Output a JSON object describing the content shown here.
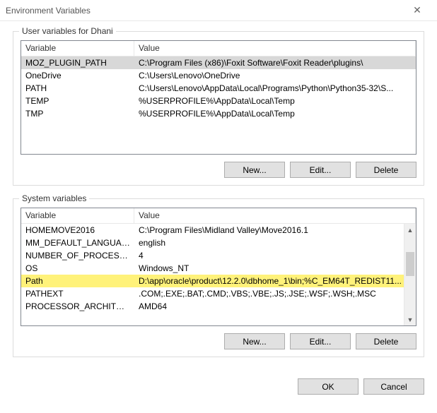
{
  "window": {
    "title": "Environment Variables",
    "close_glyph": "✕"
  },
  "user_section": {
    "label": "User variables for Dhani",
    "col_variable": "Variable",
    "col_value": "Value",
    "rows": [
      {
        "name": "MOZ_PLUGIN_PATH",
        "value": "C:\\Program Files (x86)\\Foxit Software\\Foxit Reader\\plugins\\",
        "selected": true
      },
      {
        "name": "OneDrive",
        "value": "C:\\Users\\Lenovo\\OneDrive"
      },
      {
        "name": "PATH",
        "value": "C:\\Users\\Lenovo\\AppData\\Local\\Programs\\Python\\Python35-32\\S..."
      },
      {
        "name": "TEMP",
        "value": "%USERPROFILE%\\AppData\\Local\\Temp"
      },
      {
        "name": "TMP",
        "value": "%USERPROFILE%\\AppData\\Local\\Temp"
      }
    ],
    "btn_new": "New...",
    "btn_edit": "Edit...",
    "btn_delete": "Delete"
  },
  "system_section": {
    "label": "System variables",
    "col_variable": "Variable",
    "col_value": "Value",
    "rows": [
      {
        "name": "HOMEMOVE2016",
        "value": "C:\\Program Files\\Midland Valley\\Move2016.1"
      },
      {
        "name": "MM_DEFAULT_LANGUAGE",
        "value": "english"
      },
      {
        "name": "NUMBER_OF_PROCESSORS",
        "value": "4"
      },
      {
        "name": "OS",
        "value": "Windows_NT"
      },
      {
        "name": "Path",
        "value": "D:\\app\\oracle\\product\\12.2.0\\dbhome_1\\bin;%C_EM64T_REDIST11...",
        "highlighted": true
      },
      {
        "name": "PATHEXT",
        "value": ".COM;.EXE;.BAT;.CMD;.VBS;.VBE;.JS;.JSE;.WSF;.WSH;.MSC"
      },
      {
        "name": "PROCESSOR_ARCHITECTURE",
        "value": "AMD64"
      }
    ],
    "btn_new": "New...",
    "btn_edit": "Edit...",
    "btn_delete": "Delete"
  },
  "footer": {
    "ok": "OK",
    "cancel": "Cancel"
  }
}
